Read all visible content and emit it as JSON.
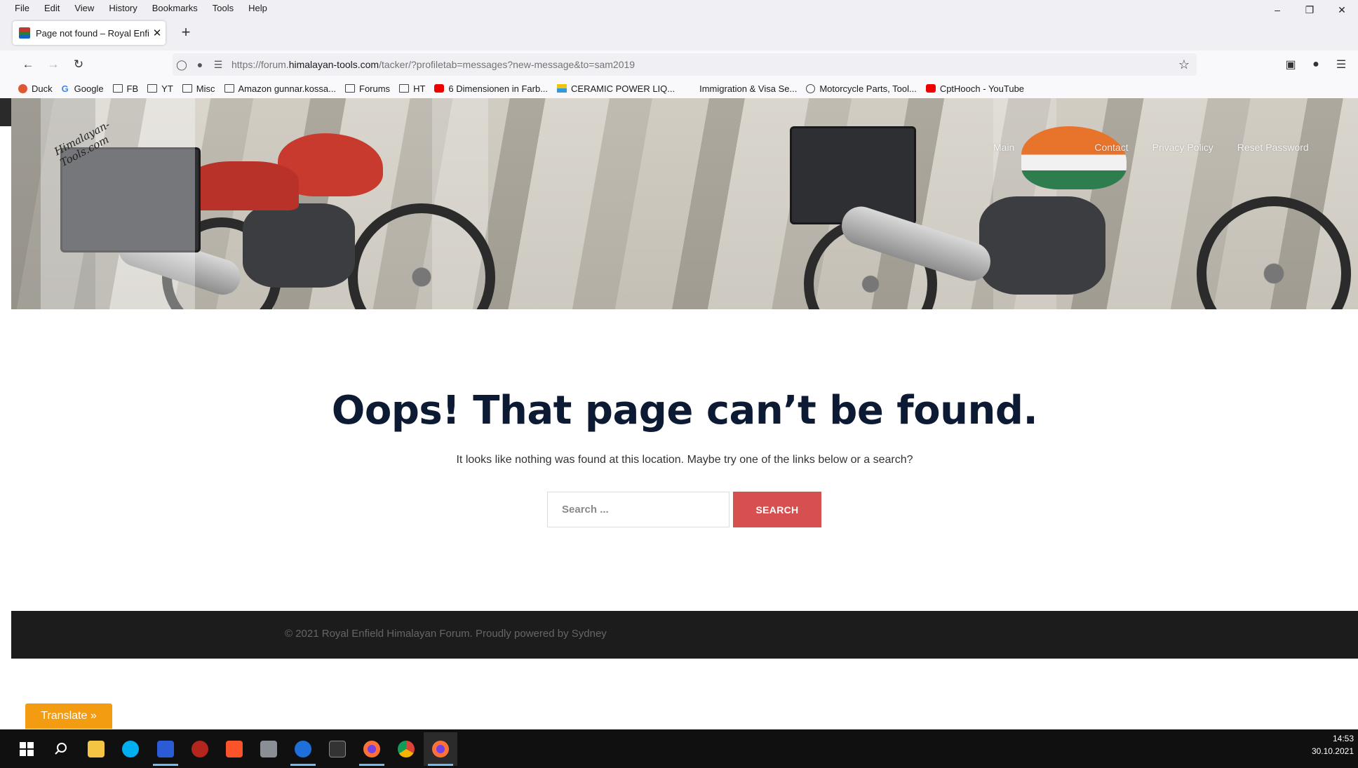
{
  "menubar": {
    "items": [
      "File",
      "Edit",
      "View",
      "History",
      "Bookmarks",
      "Tools",
      "Help"
    ]
  },
  "tab": {
    "title": "Page not found – Royal Enfield"
  },
  "urlbar": {
    "prefix": "https://forum.",
    "domain": "himalayan-tools.com",
    "path": "/tacker/?profiletab=messages?new-message&to=sam2019"
  },
  "bookmarks": [
    {
      "label": "Duck",
      "icon": "duck-icon"
    },
    {
      "label": "Google",
      "icon": "google-icon"
    },
    {
      "label": "FB",
      "icon": "folder-icon"
    },
    {
      "label": "YT",
      "icon": "folder-icon"
    },
    {
      "label": "Misc",
      "icon": "folder-icon"
    },
    {
      "label": "Amazon gunnar.kossa...",
      "icon": "folder-icon"
    },
    {
      "label": "Forums",
      "icon": "folder-icon"
    },
    {
      "label": "HT",
      "icon": "folder-icon"
    },
    {
      "label": "6 Dimensionen in Farb...",
      "icon": "youtube-icon"
    },
    {
      "label": "CERAMIC POWER LIQ...",
      "icon": "ceramic-icon"
    },
    {
      "label": "Immigration & Visa Se...",
      "icon": "blank-icon"
    },
    {
      "label": "Motorcycle Parts, Tool...",
      "icon": "globe-icon"
    },
    {
      "label": "CptHooch - YouTube",
      "icon": "youtube-icon"
    }
  ],
  "site": {
    "logo_text": "Himalayan-Tools.com",
    "nav": [
      "Main",
      "Contact",
      "Privacy Policy",
      "Reset Password"
    ]
  },
  "error": {
    "title": "Oops! That page can’t be found.",
    "description": "It looks like nothing was found at this location. Maybe try one of the links below or a search?",
    "search_placeholder": "Search ...",
    "search_button": "SEARCH"
  },
  "footer": {
    "text": "© 2021 Royal Enfield Himalayan Forum. Proudly powered by Sydney"
  },
  "translate": {
    "label": "Translate »"
  },
  "taskbar": {
    "time": "14:53",
    "date": "30.10.2021"
  },
  "colors": {
    "accent": "#d65050",
    "title": "#0c1a33",
    "footer_bg": "#1c1c1c",
    "translate_bg": "#f39c12"
  }
}
